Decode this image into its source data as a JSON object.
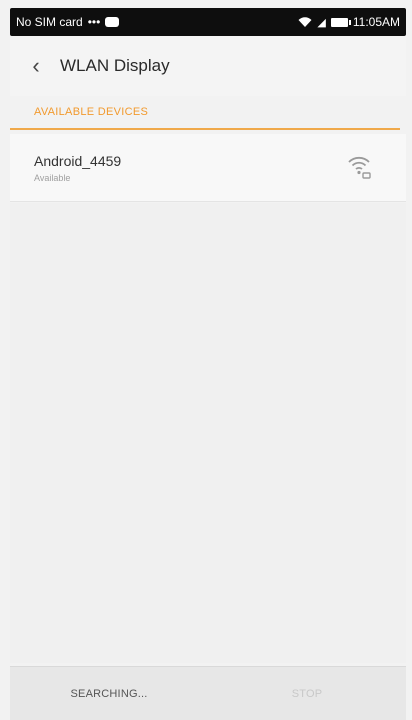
{
  "status_bar": {
    "carrier": "No SIM card",
    "dots": "•••",
    "chat_icon": "chat-bubble-icon",
    "wifi_icon": "wifi-icon",
    "signal_icon": "signal-icon",
    "battery_icon": "battery-icon",
    "time": "11:05AM"
  },
  "header": {
    "back_icon": "‹",
    "title": "WLAN Display"
  },
  "section": {
    "label": "AVAILABLE DEVICES"
  },
  "devices": [
    {
      "name": "Android_4459",
      "status": "Available",
      "icon": "cast-wifi-icon"
    }
  ],
  "bottom_bar": {
    "left_label": "SEARCHING...",
    "right_label": "STOP"
  },
  "colors": {
    "accent": "#f29a2e",
    "divider": "#f0a94a",
    "status_bar": "#0e0e0e"
  }
}
